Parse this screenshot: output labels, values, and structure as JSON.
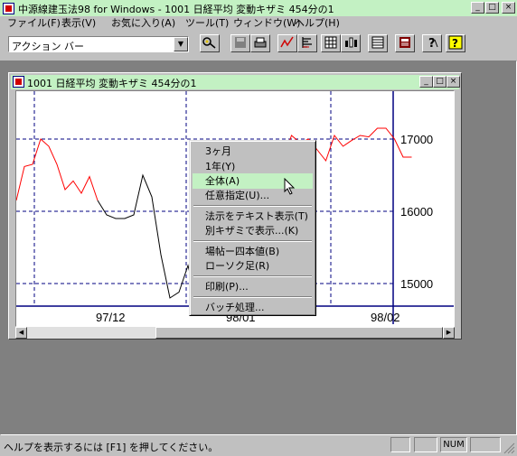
{
  "app": {
    "title": "中源線建玉法98 for Windows - 1001  日経平均  変動キザミ  454分の1",
    "min_label": "_",
    "max_label": "□",
    "close_label": "×"
  },
  "menu": [
    {
      "label": "ファイル(F)"
    },
    {
      "label": "表示(V)"
    },
    {
      "label": "お気に入り(A)"
    },
    {
      "label": "ツール(T)"
    },
    {
      "label": "ウィンドウ(W)"
    },
    {
      "label": "ヘルプ(H)"
    }
  ],
  "toolbar": {
    "combo_value": "アクション バー",
    "combo_arrow": "▼",
    "tools": [
      "key-icon",
      "save-icon",
      "print-icon",
      "line-chart-icon",
      "bar-lines-icon",
      "grid-icon",
      "candles-icon",
      "table-icon",
      "calculator-icon",
      "question-icon",
      "help-icon"
    ]
  },
  "child": {
    "title": "1001  日経平均  変動キザミ  454分の1",
    "min_label": "_",
    "max_label": "□",
    "close_label": "×"
  },
  "chart_data": {
    "type": "line",
    "y_ticks": [
      "17000",
      "16000",
      "15000"
    ],
    "x_ticks": [
      "97/12",
      "98/01",
      "98/02"
    ],
    "ylim": [
      14500,
      17500
    ],
    "grid": "dashed",
    "series": [
      {
        "color": "#ff0000",
        "segment": "up",
        "values": [
          16150,
          16620,
          16650,
          17000,
          16900,
          16650,
          16300,
          16420,
          16250,
          16480,
          16150
        ]
      },
      {
        "color": "#000000",
        "segment": "down",
        "values": [
          16150,
          15950,
          15900,
          15900,
          15950,
          16500,
          16200,
          15400,
          14800,
          14880,
          15250,
          14750,
          14750,
          15200,
          14950
        ]
      },
      {
        "color": "#ff0000",
        "segment": "up",
        "values": [
          16700,
          17050,
          16950,
          17000,
          16850,
          16700,
          17050,
          16900,
          16980,
          17050,
          17030,
          17150,
          17150,
          17000,
          16750,
          16750
        ]
      }
    ]
  },
  "context_menu": {
    "items": [
      {
        "label": "3ヶ月"
      },
      {
        "label": "1年(Y)"
      },
      {
        "label": "全体(A)"
      },
      {
        "label": "任意指定(U)..."
      },
      {
        "label": "法示をテキスト表示(T)"
      },
      {
        "label": "別キザミで表示...(K)"
      },
      {
        "label": "場帖ー四本値(B)"
      },
      {
        "label": "ローソク足(R)"
      },
      {
        "label": "印刷(P)..."
      },
      {
        "label": "バッチ処理..."
      }
    ]
  },
  "status": {
    "text": "ヘルプを表示するには [F1] を押してください。",
    "num": "NUM"
  },
  "colors": {
    "titlebar": "#c3f1c3",
    "up_line": "#ff0000",
    "down_line": "#000000",
    "grid": "#000080"
  }
}
